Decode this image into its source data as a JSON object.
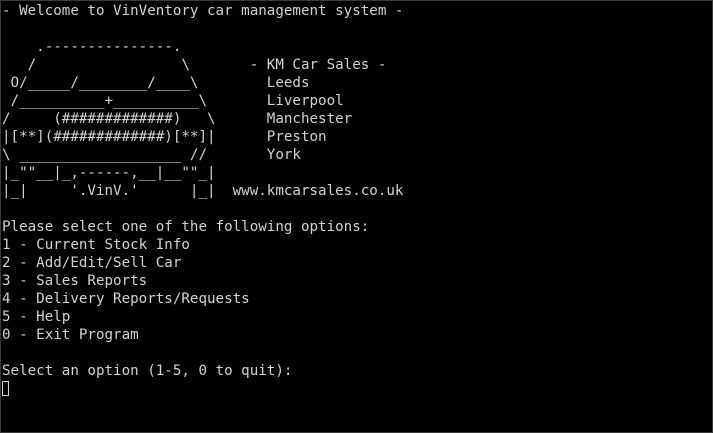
{
  "terminal": {
    "lines": [
      "- Welcome to VinVentory car management system -",
      "",
      "    .---------------.",
      "   /                 \\       - KM Car Sales -",
      " O/_____/________/____\\        Leeds",
      " /__________+__________\\       Liverpool",
      "/     (#############)   \\      Manchester",
      "|[**](#############)[**]|      Preston",
      "\\ ___________________ //       York",
      "|_\"\"__|_,------,__|__\"\"_|",
      "|_|     '.VinV.'      |_|  www.kmcarsales.co.uk",
      "",
      "Please select one of the following options:",
      "1 - Current Stock Info",
      "2 - Add/Edit/Sell Car",
      "3 - Sales Reports",
      "4 - Delivery Reports/Requests",
      "5 - Help",
      "0 - Exit Program",
      "",
      "Select an option (1-5, 0 to quit):"
    ]
  },
  "colors": {
    "background": "#000000",
    "foreground": "#d2d2d2"
  }
}
